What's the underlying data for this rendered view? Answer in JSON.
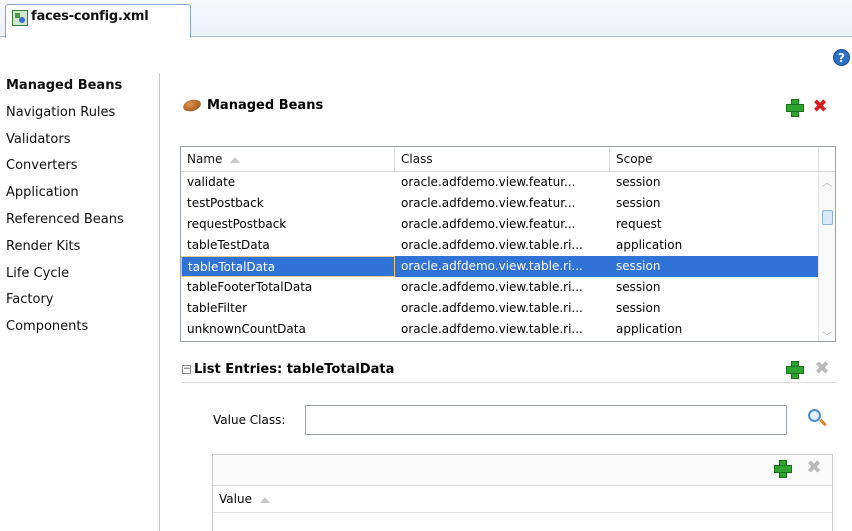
{
  "tab": {
    "label": "faces-config.xml"
  },
  "help": {
    "label": "?"
  },
  "sidebar": {
    "items": [
      {
        "label": "Managed Beans"
      },
      {
        "label": "Navigation Rules"
      },
      {
        "label": "Validators"
      },
      {
        "label": "Converters"
      },
      {
        "label": "Application"
      },
      {
        "label": "Referenced Beans"
      },
      {
        "label": "Render Kits"
      },
      {
        "label": "Life Cycle"
      },
      {
        "label": "Factory"
      },
      {
        "label": "Components"
      }
    ]
  },
  "managed_beans": {
    "title": "Managed Beans",
    "columns": [
      "Name",
      "Class",
      "Scope"
    ],
    "rows": [
      {
        "name": "validate",
        "class": "oracle.adfdemo.view.featur...",
        "scope": "session"
      },
      {
        "name": "testPostback",
        "class": "oracle.adfdemo.view.featur...",
        "scope": "session"
      },
      {
        "name": "requestPostback",
        "class": "oracle.adfdemo.view.featur...",
        "scope": "request"
      },
      {
        "name": "tableTestData",
        "class": "oracle.adfdemo.view.table.ri...",
        "scope": "application"
      },
      {
        "name": "tableTotalData",
        "class": "oracle.adfdemo.view.table.ri...",
        "scope": "session"
      },
      {
        "name": "tableFooterTotalData",
        "class": "oracle.adfdemo.view.table.ri...",
        "scope": "session"
      },
      {
        "name": "tableFilter",
        "class": "oracle.adfdemo.view.table.ri...",
        "scope": "session"
      },
      {
        "name": "unknownCountData",
        "class": "oracle.adfdemo.view.table.ri...",
        "scope": "application"
      }
    ],
    "selected_row": "tableTotalData"
  },
  "list_entries": {
    "title": "List Entries: tableTotalData",
    "collapse_glyph": "−",
    "value_class_label": "Value Class:",
    "value_class_value": "",
    "value_column": "Value"
  },
  "icons": {
    "add": "add-icon",
    "delete": "delete-icon",
    "search": "search-icon"
  },
  "colors": {
    "selection": "#3072d6",
    "add_green": "#2ea32e",
    "delete_red": "#d71d1d"
  }
}
